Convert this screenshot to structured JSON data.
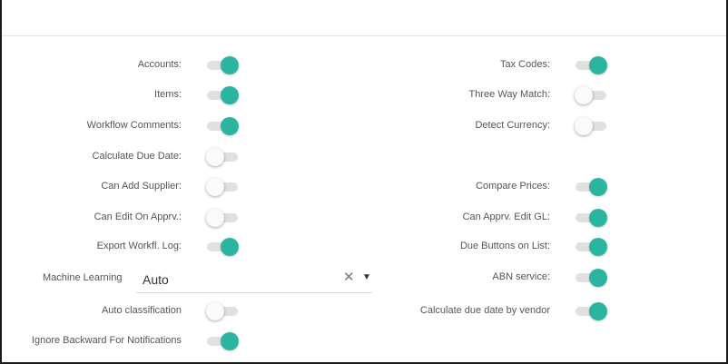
{
  "left_settings": [
    {
      "label": "Accounts:",
      "on": true
    },
    {
      "label": "Items:",
      "on": true
    },
    {
      "label": "Workflow Comments:",
      "on": true
    },
    {
      "label": "Calculate Due Date:",
      "on": false
    },
    {
      "label": "Can Add Supplier:",
      "on": false
    },
    {
      "label": "Can Edit On Apprv.:",
      "on": false
    },
    {
      "label": "Export Workfl. Log:",
      "on": true
    }
  ],
  "machine_learning": {
    "label": "Machine Learning",
    "value": "Auto",
    "clear_glyph": "✕",
    "arrow_glyph": "▼"
  },
  "auto_classification": {
    "label": "Auto classification",
    "on": false
  },
  "ignore_backward": {
    "label": "Ignore Backward For Notifications",
    "on": true
  },
  "right_settings": [
    {
      "label": "Tax Codes:",
      "on": true
    },
    {
      "label": "Three Way Match:",
      "on": false
    },
    {
      "label": "Detect Currency:",
      "on": false
    },
    {
      "label": "Compare Prices:",
      "on": true
    },
    {
      "label": "Can Apprv. Edit GL:",
      "on": true
    },
    {
      "label": "Due Buttons on List:",
      "on": true
    },
    {
      "label": "ABN service:",
      "on": true
    },
    {
      "label": "Calculate due date by vendor",
      "on": true
    }
  ],
  "colors": {
    "accent": "#2bb5a0",
    "track": "#e0e0e0",
    "text": "#555555"
  }
}
